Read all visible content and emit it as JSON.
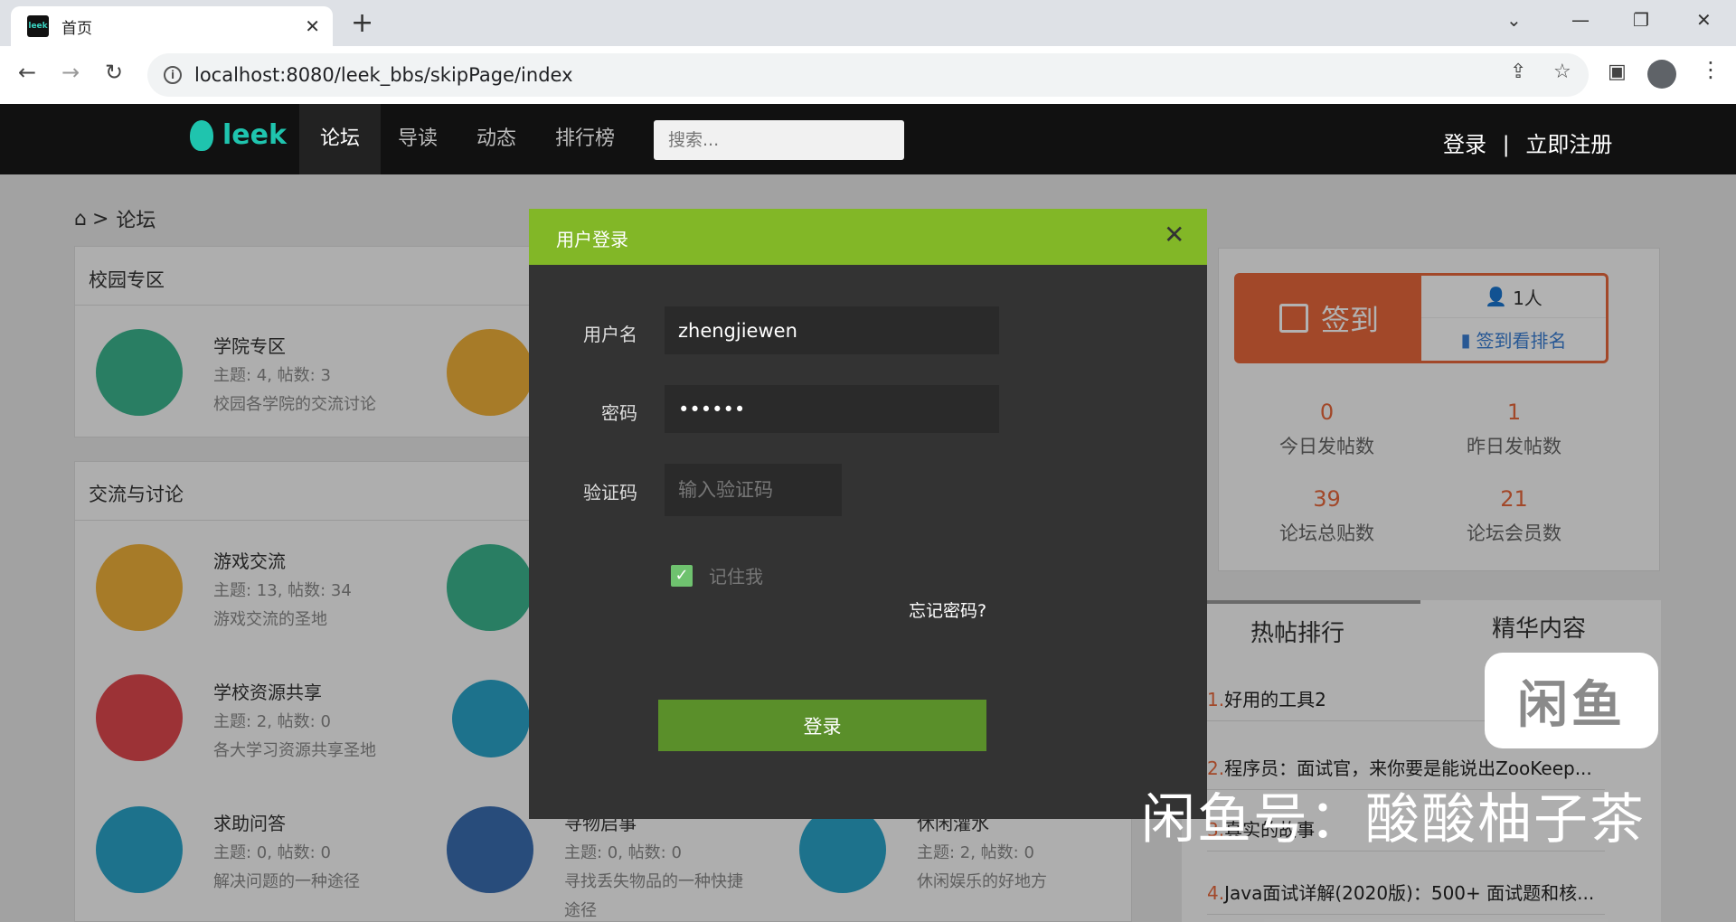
{
  "browser": {
    "tab_title": "首页",
    "url": "localhost:8080/leek_bbs/skipPage/index"
  },
  "navbar": {
    "logo_text": "leek",
    "items": [
      {
        "label": "论坛",
        "active": true
      },
      {
        "label": "导读"
      },
      {
        "label": "动态"
      },
      {
        "label": "排行榜"
      }
    ],
    "search_placeholder": "搜索...",
    "login": "登录",
    "separator": "|",
    "register": "立即注册"
  },
  "breadcrumb": {
    "current": "论坛",
    "sep": ">"
  },
  "sections": [
    {
      "title": "校园专区",
      "forums": [
        {
          "name": "学院专区",
          "stats": "主题: 4, 帖数: 3",
          "desc": "校园各学院的交流讨论",
          "color": "#3bb58f"
        }
      ]
    },
    {
      "title": "交流与讨论",
      "forums": [
        {
          "name": "游戏交流",
          "stats": "主题: 13, 帖数: 34",
          "desc": "游戏交流的圣地",
          "color": "#f0b13a"
        },
        {
          "name": "学校资源共享",
          "stats": "主题: 2, 帖数: 0",
          "desc": "各大学习资源共享圣地",
          "color": "#e0484e"
        },
        {
          "name": "求助问答",
          "stats": "主题: 0, 帖数: 0",
          "desc": "解决问题的一种途径",
          "color": "#2aa4c9"
        },
        {
          "name": "寻物启事",
          "stats": "主题: 0, 帖数: 0",
          "desc": "寻找丢失物品的一种快捷",
          "desc2": "途径",
          "color": "#3a6db0"
        },
        {
          "name": "休闲灌水",
          "stats": "主题: 2, 帖数: 0",
          "desc": "休闲娱乐的好地方",
          "color": "#2aa4c9"
        }
      ]
    }
  ],
  "sidebar": {
    "checkin_label": "签到",
    "checkin_count": "1人",
    "checkin_rank": "签到看排名",
    "stats": [
      {
        "value": "0",
        "label": "今日发帖数"
      },
      {
        "value": "1",
        "label": "昨日发帖数"
      },
      {
        "value": "39",
        "label": "论坛总贴数"
      },
      {
        "value": "21",
        "label": "论坛会员数"
      }
    ],
    "tabs": [
      "热帖排行",
      "精华内容"
    ],
    "hot": [
      {
        "rank": "1.",
        "title": "好用的工具2"
      },
      {
        "rank": "2.",
        "title": "程序员：面试官，来你要是能说出ZooKeep..."
      },
      {
        "rank": "3.",
        "title": "真实的故事"
      },
      {
        "rank": "4.",
        "title": "Java面试详解(2020版)：500+ 面试题和核..."
      }
    ]
  },
  "modal": {
    "title": "用户登录",
    "username_label": "用户名",
    "username_value": "zhengjiewen",
    "password_label": "密码",
    "password_value": "••••••",
    "captcha_label": "验证码",
    "captcha_placeholder": "输入验证码",
    "remember": "记住我",
    "forgot": "忘记密码?",
    "submit": "登录"
  },
  "watermark": {
    "logo": "闲鱼",
    "text": "闲鱼号：酸酸柚子茶"
  },
  "colors": {
    "accent_green": "#82b727",
    "button_green": "#5a8f2a",
    "checkin_orange": "#e8683c",
    "brand_teal": "#1fc4ae"
  }
}
